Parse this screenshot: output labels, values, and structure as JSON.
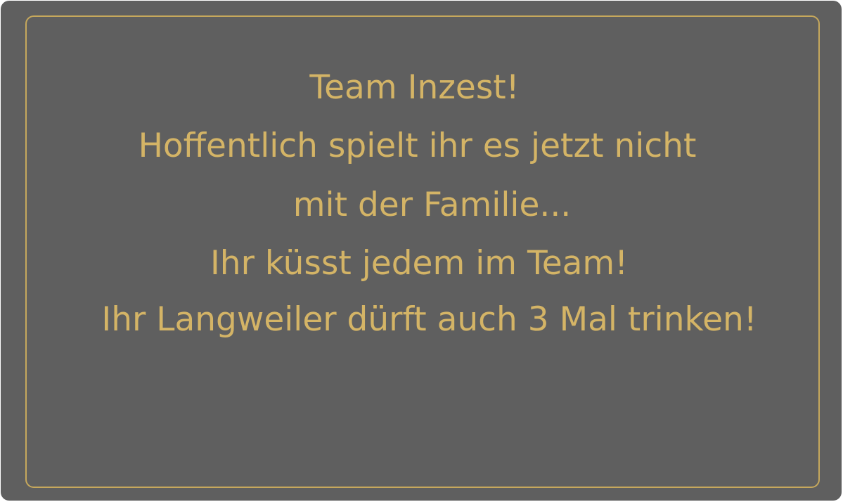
{
  "card": {
    "lines": [
      "Team Inzest!",
      "Hoffentlich spielt ihr es jetzt nicht",
      "mit der Familie...",
      "Ihr küsst jedem im Team!",
      "Ihr Langweiler dürft auch 3 Mal trinken!"
    ]
  },
  "colors": {
    "background": "#5f5f5f",
    "text": "#d4b466",
    "border": "#c6a85c"
  }
}
